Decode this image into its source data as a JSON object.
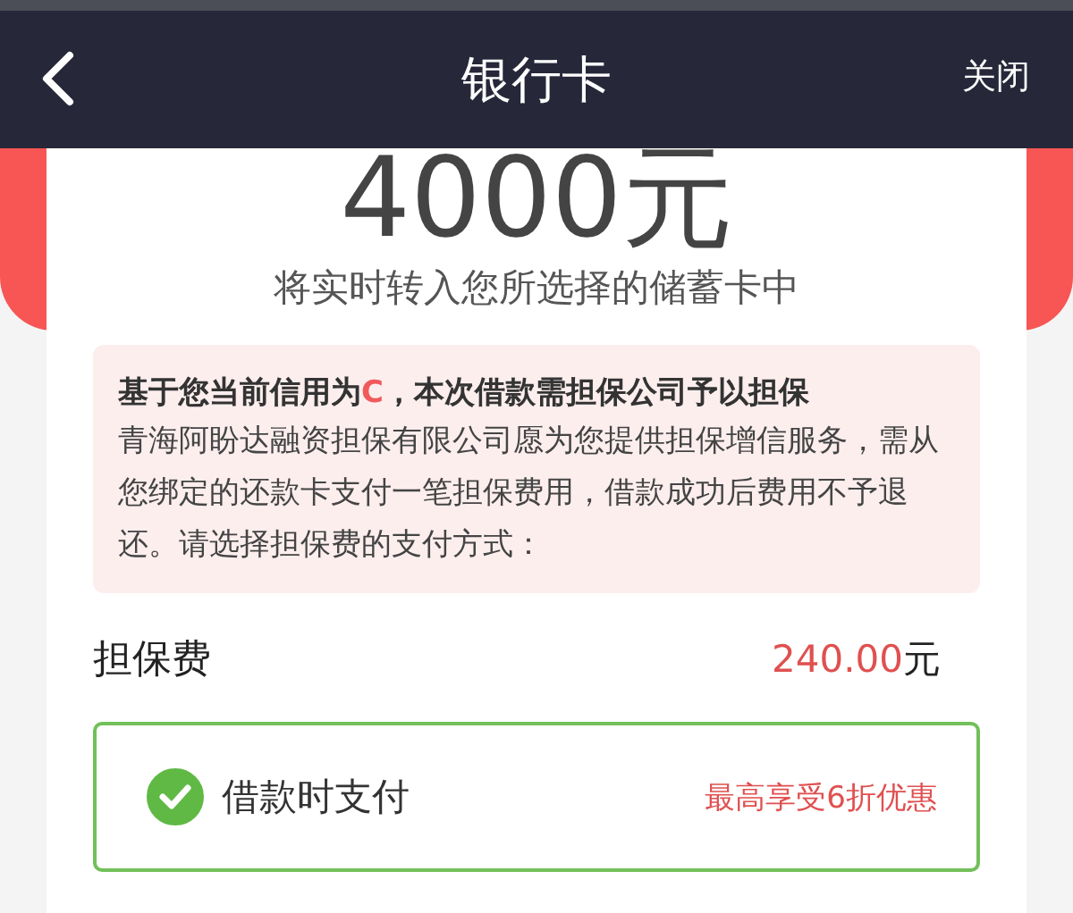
{
  "nav": {
    "title": "银行卡",
    "close": "关闭"
  },
  "amount": "4000元",
  "subtitle": "将实时转入您所选择的储蓄卡中",
  "notice": {
    "heading": {
      "prefix": "基于您当前信用为",
      "grade": "C",
      "suffix": "，本次借款需担保公司予以担保"
    },
    "body": "青海阿盼达融资担保有限公司愿为您提供担保增信服务，需从您绑定的还款卡支付一笔担保费用，借款成功后费用不予退还。请选择担保费的支付方式："
  },
  "fee": {
    "label": "担保费",
    "amount": "240.00",
    "unit": "元"
  },
  "options": [
    {
      "label": "借款时支付",
      "note": "最高享受6折优惠",
      "selected": true
    }
  ]
}
